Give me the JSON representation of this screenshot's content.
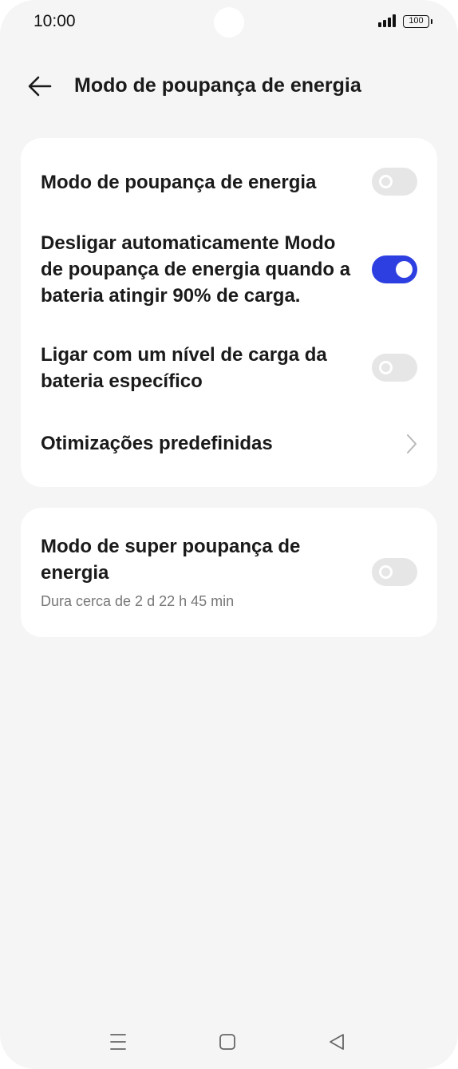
{
  "status_bar": {
    "time": "10:00",
    "battery": "100",
    "icons": [
      "signal-icon",
      "battery-icon"
    ]
  },
  "header": {
    "title": "Modo de poupança de energia",
    "back_icon": "arrow-left-icon"
  },
  "settings": [
    {
      "label": "Modo de poupança de energia",
      "toggle": false
    },
    {
      "label": "Desligar automaticamente Modo de poupança de energia quando a bateria atingir 90% de carga.",
      "toggle": true
    },
    {
      "label": "Ligar com um nível de carga da bateria específico",
      "toggle": false
    },
    {
      "label": "Otimizações predefinidas",
      "icon": "chevron-right-icon"
    }
  ],
  "super_saving": {
    "label": "Modo de super poupança de energia",
    "subtitle": "Dura cerca de 2 d 22 h 45 min",
    "toggle": false
  },
  "nav_bar": {
    "icons": [
      "menu-icon",
      "home-icon",
      "back-triangle-icon"
    ]
  },
  "colors": {
    "accent": "#2d3fe0",
    "background": "#f5f5f5",
    "card": "#ffffff",
    "toggle_off": "#e6e6e6"
  }
}
